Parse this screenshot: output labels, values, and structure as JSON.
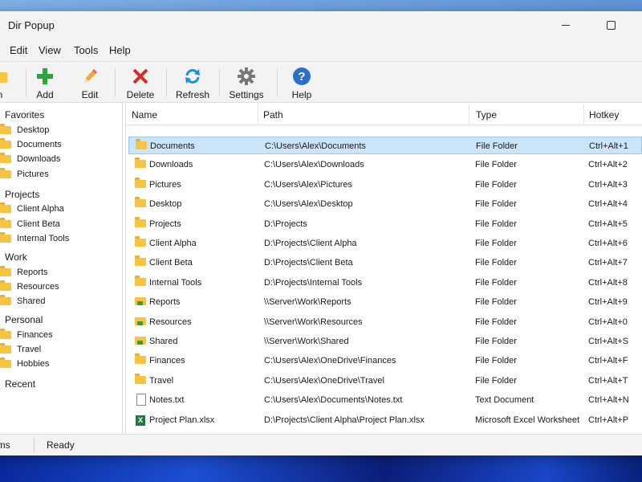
{
  "window": {
    "title": "Dir Popup"
  },
  "menu": [
    "Edit",
    "View",
    "Tools",
    "Help"
  ],
  "toolbar": {
    "open_label": "n",
    "add_label": "Add",
    "edit_label": "Edit",
    "delete_label": "Delete",
    "refresh_label": "Refresh",
    "settings_label": "Settings",
    "help_label": "Help"
  },
  "sidebar": {
    "favorites": {
      "label": "Favorites",
      "items": [
        "Desktop",
        "Documents",
        "Downloads",
        "Pictures"
      ]
    },
    "projects": {
      "label": "Projects",
      "items": [
        "Client Alpha",
        "Client Beta",
        "Internal Tools"
      ]
    },
    "work": {
      "label": "Work",
      "items": [
        "Reports",
        "Resources",
        "Shared"
      ]
    },
    "personal": {
      "label": "Personal",
      "items": [
        "Finances",
        "Travel",
        "Hobbies"
      ]
    },
    "recent": {
      "label": "Recent"
    }
  },
  "list": {
    "columns": [
      "Name",
      "Path",
      "Type",
      "Hotkey"
    ],
    "rows": [
      {
        "name": "Documents",
        "path": "C:\\Users\\Alex\\Documents",
        "type": "File Folder",
        "hotkey": "Ctrl+Alt+1",
        "icon": "folder-icon",
        "selected": true
      },
      {
        "name": "Downloads",
        "path": "C:\\Users\\Alex\\Downloads",
        "type": "File Folder",
        "hotkey": "Ctrl+Alt+2",
        "icon": "folder-icon"
      },
      {
        "name": "Pictures",
        "path": "C:\\Users\\Alex\\Pictures",
        "type": "File Folder",
        "hotkey": "Ctrl+Alt+3",
        "icon": "folder-icon"
      },
      {
        "name": "Desktop",
        "path": "C:\\Users\\Alex\\Desktop",
        "type": "File Folder",
        "hotkey": "Ctrl+Alt+4",
        "icon": "folder-icon"
      },
      {
        "name": "Projects",
        "path": "D:\\Projects",
        "type": "File Folder",
        "hotkey": "Ctrl+Alt+5",
        "icon": "folder-icon"
      },
      {
        "name": "Client Alpha",
        "path": "D:\\Projects\\Client Alpha",
        "type": "File Folder",
        "hotkey": "Ctrl+Alt+6",
        "icon": "folder-icon"
      },
      {
        "name": "Client Beta",
        "path": "D:\\Projects\\Client Beta",
        "type": "File Folder",
        "hotkey": "Ctrl+Alt+7",
        "icon": "folder-icon"
      },
      {
        "name": "Internal Tools",
        "path": "D:\\Projects\\Internal Tools",
        "type": "File Folder",
        "hotkey": "Ctrl+Alt+8",
        "icon": "folder-icon"
      },
      {
        "name": "Reports",
        "path": "\\\\Server\\Work\\Reports",
        "type": "File Folder",
        "hotkey": "Ctrl+Alt+9",
        "icon": "network-folder-icon"
      },
      {
        "name": "Resources",
        "path": "\\\\Server\\Work\\Resources",
        "type": "File Folder",
        "hotkey": "Ctrl+Alt+0",
        "icon": "network-folder-icon"
      },
      {
        "name": "Shared",
        "path": "\\\\Server\\Work\\Shared",
        "type": "File Folder",
        "hotkey": "Ctrl+Alt+S",
        "icon": "network-folder-icon"
      },
      {
        "name": "Finances",
        "path": "C:\\Users\\Alex\\OneDrive\\Finances",
        "type": "File Folder",
        "hotkey": "Ctrl+Alt+F",
        "icon": "folder-icon"
      },
      {
        "name": "Travel",
        "path": "C:\\Users\\Alex\\OneDrive\\Travel",
        "type": "File Folder",
        "hotkey": "Ctrl+Alt+T",
        "icon": "folder-icon"
      },
      {
        "name": "Notes.txt",
        "path": "C:\\Users\\Alex\\Documents\\Notes.txt",
        "type": "Text Document",
        "hotkey": "Ctrl+Alt+N",
        "icon": "text-document-icon"
      },
      {
        "name": "Project Plan.xlsx",
        "path": "D:\\Projects\\Client Alpha\\Project Plan.xlsx",
        "type": "Microsoft Excel Worksheet",
        "hotkey": "Ctrl+Alt+P",
        "icon": "excel-file-icon"
      }
    ]
  },
  "status": {
    "items_label": "ems",
    "state": "Ready"
  }
}
